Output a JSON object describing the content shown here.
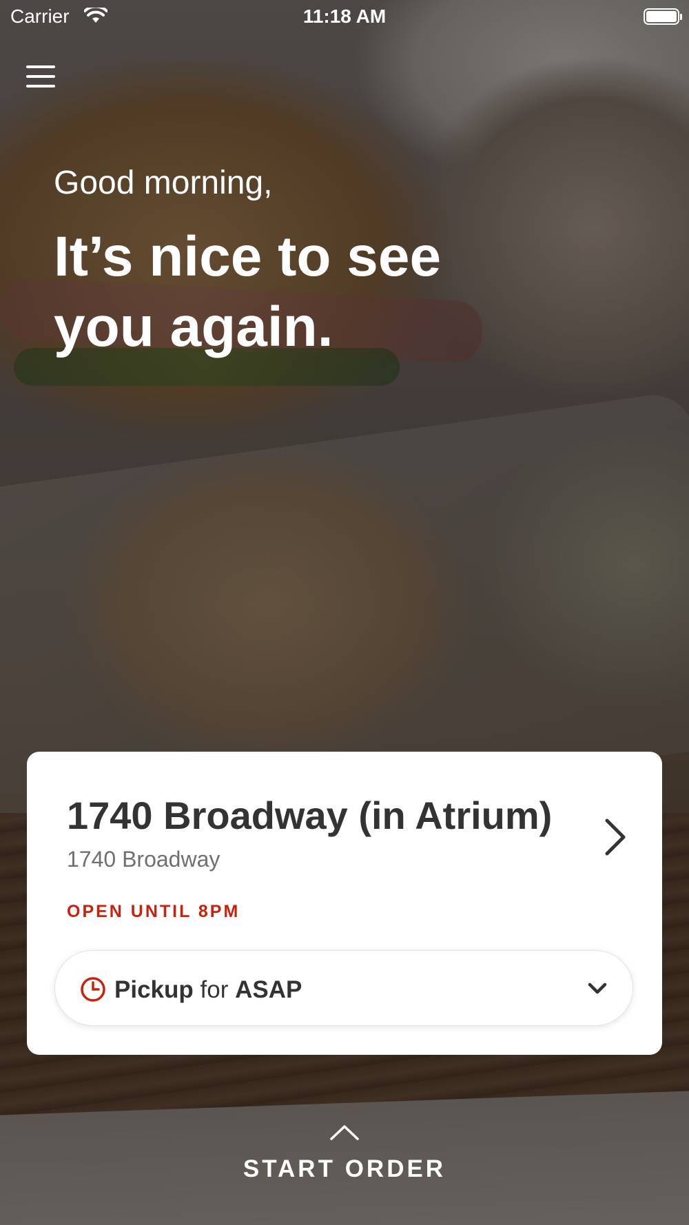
{
  "status_bar": {
    "carrier": "Carrier",
    "time": "11:18 AM"
  },
  "header": {
    "menu_icon": "hamburger-menu-icon"
  },
  "hero": {
    "greeting": "Good morning,",
    "headline": "It’s nice to see you again."
  },
  "store_card": {
    "name": "1740 Broadway (in Atrium)",
    "address": "1740 Broadway",
    "hours": "OPEN UNTIL 8PM",
    "chevron_icon": "chevron-right-icon"
  },
  "order_mode": {
    "icon": "clock-icon",
    "mode": "Pickup",
    "connector": "for",
    "time": "ASAP",
    "dropdown_icon": "chevron-down-icon"
  },
  "footer": {
    "icon": "chevron-up-icon",
    "start_order_label": "START ORDER"
  },
  "colors": {
    "accent_red": "#c8210d",
    "text_dark": "#333333",
    "text_muted": "#6f6f6f",
    "card_bg": "#ffffff"
  }
}
